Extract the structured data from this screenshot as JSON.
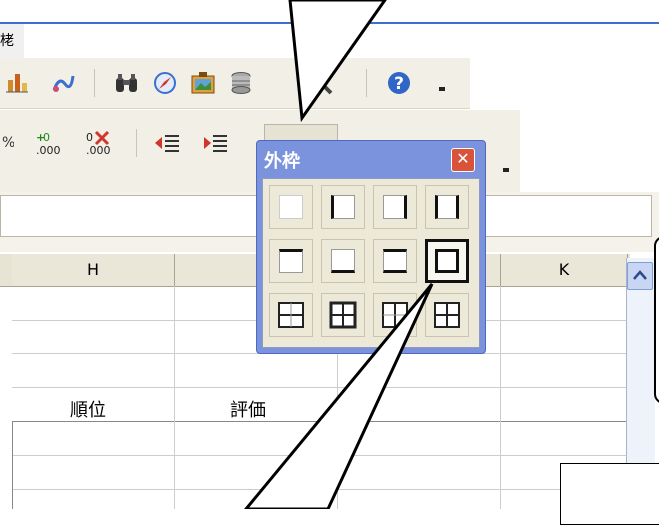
{
  "window": {
    "title_fragment": "栳"
  },
  "toolbar1": {
    "icons": [
      "chart-icon",
      "draw-icon",
      "find-binoculars-icon",
      "navigator-icon",
      "gallery-icon",
      "data-sources-icon",
      "zoom-icon",
      "help-icon",
      "toolbar-options-icon"
    ]
  },
  "toolbar2": {
    "icons": [
      "percent-format-icon",
      "add-decimal-icon",
      "delete-decimal-icon",
      "decrease-indent-icon",
      "increase-indent-icon",
      "borders-icon",
      "toolbar-options-icon"
    ]
  },
  "palette": {
    "title": "外枠",
    "close_label": "✕",
    "selected_index": 7
  },
  "columns": [
    "H",
    "K"
  ],
  "cells": {
    "rank": "順位",
    "rating": "評価"
  },
  "scrollbar": {
    "up_arrow": "^"
  }
}
